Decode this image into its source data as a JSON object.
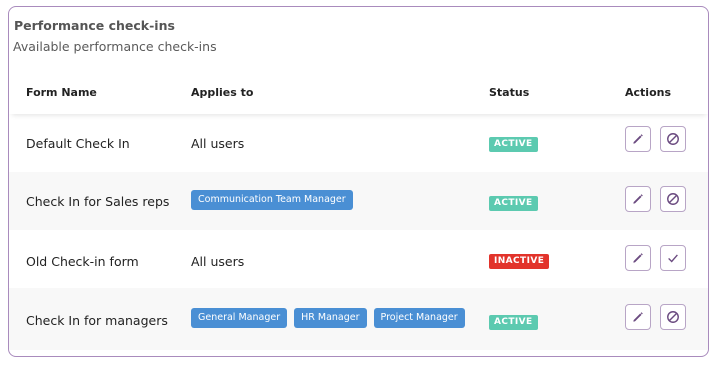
{
  "card": {
    "title": "Performance check-ins",
    "subtitle": "Available performance check-ins"
  },
  "table": {
    "headers": {
      "form_name": "Form Name",
      "applies_to": "Applies to",
      "status": "Status",
      "actions": "Actions"
    },
    "rows": [
      {
        "name": "Default Check In",
        "applies_text": "All users",
        "tags": [],
        "status": "ACTIVE",
        "secondary_action": "disable-icon"
      },
      {
        "name": "Check In for Sales reps",
        "applies_text": "",
        "tags": [
          "Communication Team Manager"
        ],
        "status": "ACTIVE",
        "secondary_action": "disable-icon"
      },
      {
        "name": "Old Check-in form",
        "applies_text": "All users",
        "tags": [],
        "status": "INACTIVE",
        "secondary_action": "checkmark-icon"
      },
      {
        "name": "Check In for managers",
        "applies_text": "",
        "tags": [
          "General Manager",
          "HR Manager",
          "Project Manager"
        ],
        "status": "ACTIVE",
        "secondary_action": "disable-icon"
      }
    ]
  },
  "colors": {
    "card_border": "#a98bbd",
    "tag_bg": "#4a8fd4",
    "status_active": "#5ccab0",
    "status_inactive": "#e2332b",
    "icon": "#6b4b80"
  }
}
